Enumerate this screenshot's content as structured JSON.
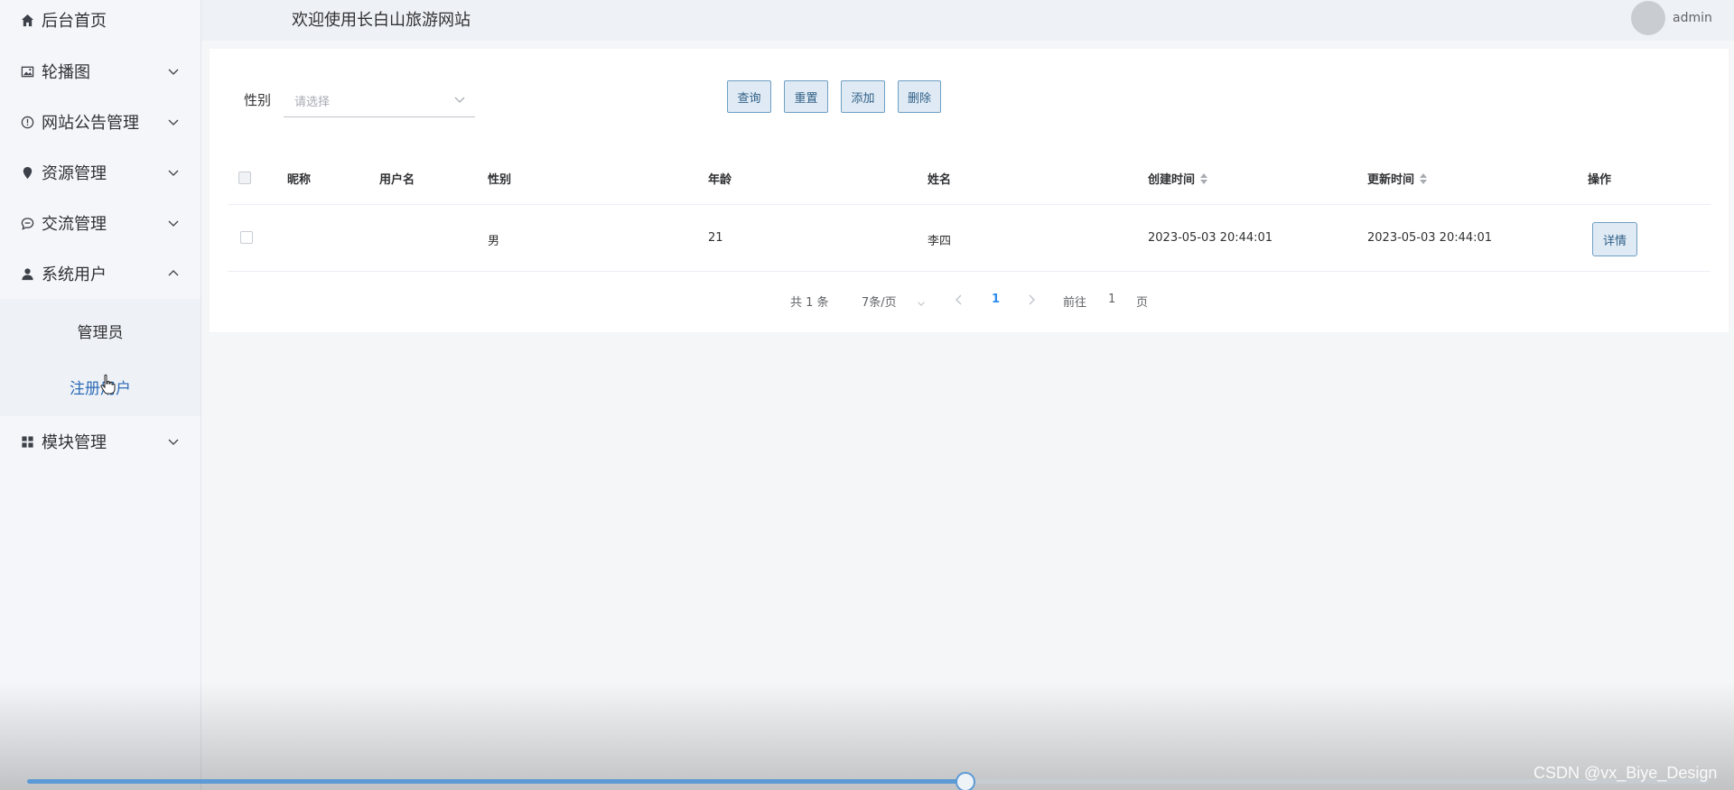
{
  "header": {
    "title": "欢迎使用长白山旅游网站",
    "user_name": "admin"
  },
  "sidebar": {
    "items": [
      {
        "label": "后台首页",
        "icon": "home-icon"
      },
      {
        "label": "轮播图",
        "icon": "image-icon"
      },
      {
        "label": "网站公告管理",
        "icon": "info-icon"
      },
      {
        "label": "资源管理",
        "icon": "location-icon"
      },
      {
        "label": "交流管理",
        "icon": "chat-icon"
      },
      {
        "label": "系统用户",
        "icon": "user-icon",
        "expanded": true
      },
      {
        "label": "模块管理",
        "icon": "grid-icon"
      }
    ],
    "submenu": [
      {
        "label": "管理员"
      },
      {
        "label": "注册用户",
        "active": true
      }
    ]
  },
  "filter": {
    "label": "性别",
    "placeholder": "请选择"
  },
  "buttons": {
    "query": "查询",
    "reset": "重置",
    "add": "添加",
    "delete": "删除"
  },
  "table": {
    "headers": [
      "昵称",
      "用户名",
      "性别",
      "年龄",
      "姓名",
      "创建时间",
      "更新时间",
      "操作"
    ],
    "rows": [
      {
        "nickname": "",
        "username": "",
        "gender": "男",
        "age": "21",
        "name": "李四",
        "created": "2023-05-03 20:44:01",
        "updated": "2023-05-03 20:44:01",
        "action": "详情"
      }
    ]
  },
  "pagination": {
    "total": "共 1 条",
    "page_size": "7条/页",
    "current": "1",
    "goto_prefix": "前往",
    "goto_value": "1",
    "goto_suffix": "页"
  },
  "player": {
    "progress": 0.558
  },
  "watermark": "CSDN @vx_Biye_Design",
  "colors": {
    "accent": "#2d6bb7",
    "button_bg": "#dfeaf4",
    "button_border": "#6f9fc3",
    "progress": "#5c9ad6"
  }
}
